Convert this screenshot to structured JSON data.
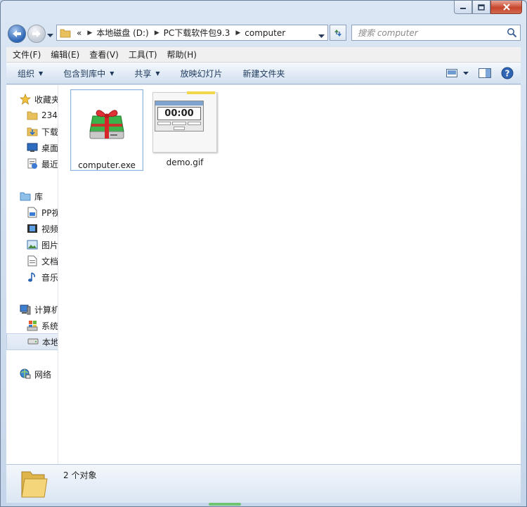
{
  "window": {
    "address": {
      "crumbs": [
        "«",
        "本地磁盘 (D:)",
        "PC下载软件包9.3",
        "computer"
      ]
    },
    "search": {
      "placeholder": "搜索 computer"
    }
  },
  "menubar": {
    "items": [
      "文件(F)",
      "编辑(E)",
      "查看(V)",
      "工具(T)",
      "帮助(H)"
    ]
  },
  "commandbar": {
    "organize": "组织",
    "include": "包含到库中",
    "share": "共享",
    "slideshow": "放映幻灯片",
    "newfolder": "新建文件夹"
  },
  "navpane": {
    "favorites": {
      "label": "收藏夹",
      "items": [
        "234",
        "下载",
        "桌面",
        "最近访问的位置"
      ]
    },
    "libraries": {
      "label": "库",
      "items": [
        "PP视频",
        "视频",
        "图片",
        "文档",
        "音乐"
      ]
    },
    "computer": {
      "label": "计算机",
      "items": [
        "系统 (C:)",
        "本地磁盘 (D:)"
      ]
    },
    "network": {
      "label": "网络"
    }
  },
  "files": [
    {
      "name": "computer.exe",
      "icon": "gift-drive-icon",
      "selected": true
    },
    {
      "name": "demo.gif",
      "icon": "timer-preview-thumbnail",
      "preview_time": "00:00"
    }
  ],
  "status": {
    "count_text": "2 个对象"
  },
  "colors": {
    "accent": "#1e395b",
    "selection": "#8fb4e0"
  }
}
